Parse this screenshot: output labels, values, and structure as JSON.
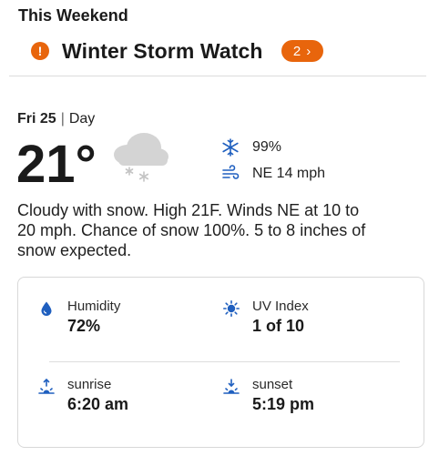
{
  "section": {
    "title": "This Weekend"
  },
  "alert": {
    "icon": "exclamation-icon",
    "text": "Winter Storm Watch",
    "badge_count": "2",
    "badge_chevron": "›"
  },
  "forecast": {
    "day": "Fri 25",
    "period": "Day",
    "temperature": "21°",
    "condition_icon": "cloud-snow-icon",
    "precip": "99%",
    "precip_icon": "snowflake-icon",
    "wind": "NE 14 mph",
    "wind_icon": "wind-icon",
    "description": "Cloudy with snow. High 21F. Winds NE at 10 to 20 mph. Chance of snow 100%. 5 to 8 inches of snow expected."
  },
  "details": {
    "humidity": {
      "label": "Humidity",
      "value": "72%",
      "icon": "drop-icon"
    },
    "uv": {
      "label": "UV Index",
      "value": "1 of 10",
      "icon": "sun-icon"
    },
    "sunrise": {
      "label": "sunrise",
      "value": "6:20 am",
      "icon": "sunrise-icon"
    },
    "sunset": {
      "label": "sunset",
      "value": "5:19 pm",
      "icon": "sunset-icon"
    }
  },
  "colors": {
    "accent": "#e8650c",
    "icon_blue": "#1f5fbf"
  }
}
